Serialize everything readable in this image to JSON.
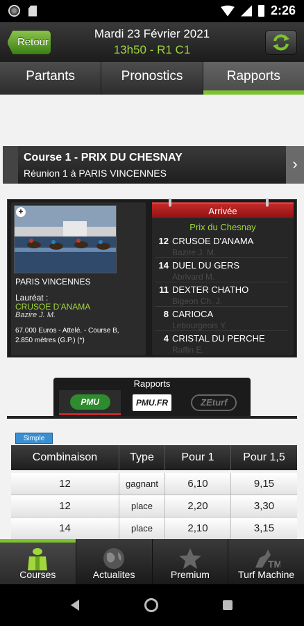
{
  "status_bar": {
    "time": "2:26"
  },
  "header": {
    "back_label": "Retour",
    "date": "Mardi 23 Février 2021",
    "race_code": "13h50 - R1 C1"
  },
  "tabs": [
    {
      "label": "Partants"
    },
    {
      "label": "Pronostics"
    },
    {
      "label": "Rapports",
      "active": true
    }
  ],
  "course": {
    "title": "Course 1 - PRIX DU CHESNAY",
    "subtitle": "Réunion 1 à PARIS VINCENNES"
  },
  "race_card": {
    "venue": "PARIS VINCENNES",
    "laureat_label": "Lauréat :",
    "laureat_horse": "CRUSOE D'ANAMA",
    "laureat_jockey": "Bazire J. M.",
    "info_line1": "67.000 Euros - Attelé. - Course B,",
    "info_line2": "2.850 mètres (G.P.) (*)"
  },
  "arrivee": {
    "header": "Arrivée",
    "prix": "Prix du Chesnay",
    "rows": [
      {
        "num": "12",
        "horse": "CRUSOE D'ANAMA",
        "jockey": "Bazire J. M."
      },
      {
        "num": "14",
        "horse": "DUEL DU GERS",
        "jockey": "Abrivard M."
      },
      {
        "num": "11",
        "horse": "DEXTER CHATHO",
        "jockey": "Bigeon Ch. J."
      },
      {
        "num": "8",
        "horse": "CARIOCA",
        "jockey": "Lebourgeois Y."
      },
      {
        "num": "4",
        "horse": "CRISTAL DU PERCHE",
        "jockey": "Raffin E."
      }
    ]
  },
  "rapports": {
    "title": "Rapports",
    "sources": [
      {
        "label": "PMU",
        "active": true
      },
      {
        "label": "PMU.FR"
      },
      {
        "label": "ZEturf"
      }
    ]
  },
  "simple": {
    "badge": "Simple",
    "headers": [
      "Combinaison",
      "Type",
      "Pour 1",
      "Pour 1,5"
    ],
    "rows": [
      [
        "12",
        "gagnant",
        "6,10",
        "9,15"
      ],
      [
        "12",
        "place",
        "2,20",
        "3,30"
      ],
      [
        "14",
        "place",
        "2,10",
        "3,15"
      ]
    ]
  },
  "bottom_nav": [
    {
      "label": "Courses",
      "icon": "jockey-icon",
      "active": true
    },
    {
      "label": "Actualites",
      "icon": "globe-icon"
    },
    {
      "label": "Premium",
      "icon": "star-icon"
    },
    {
      "label": "Turf Machine",
      "icon": "turf-machine-icon"
    }
  ],
  "colors": {
    "accent_green": "#7cc42d",
    "text_green": "#9fd838",
    "arrivee_red": "#c62828"
  }
}
